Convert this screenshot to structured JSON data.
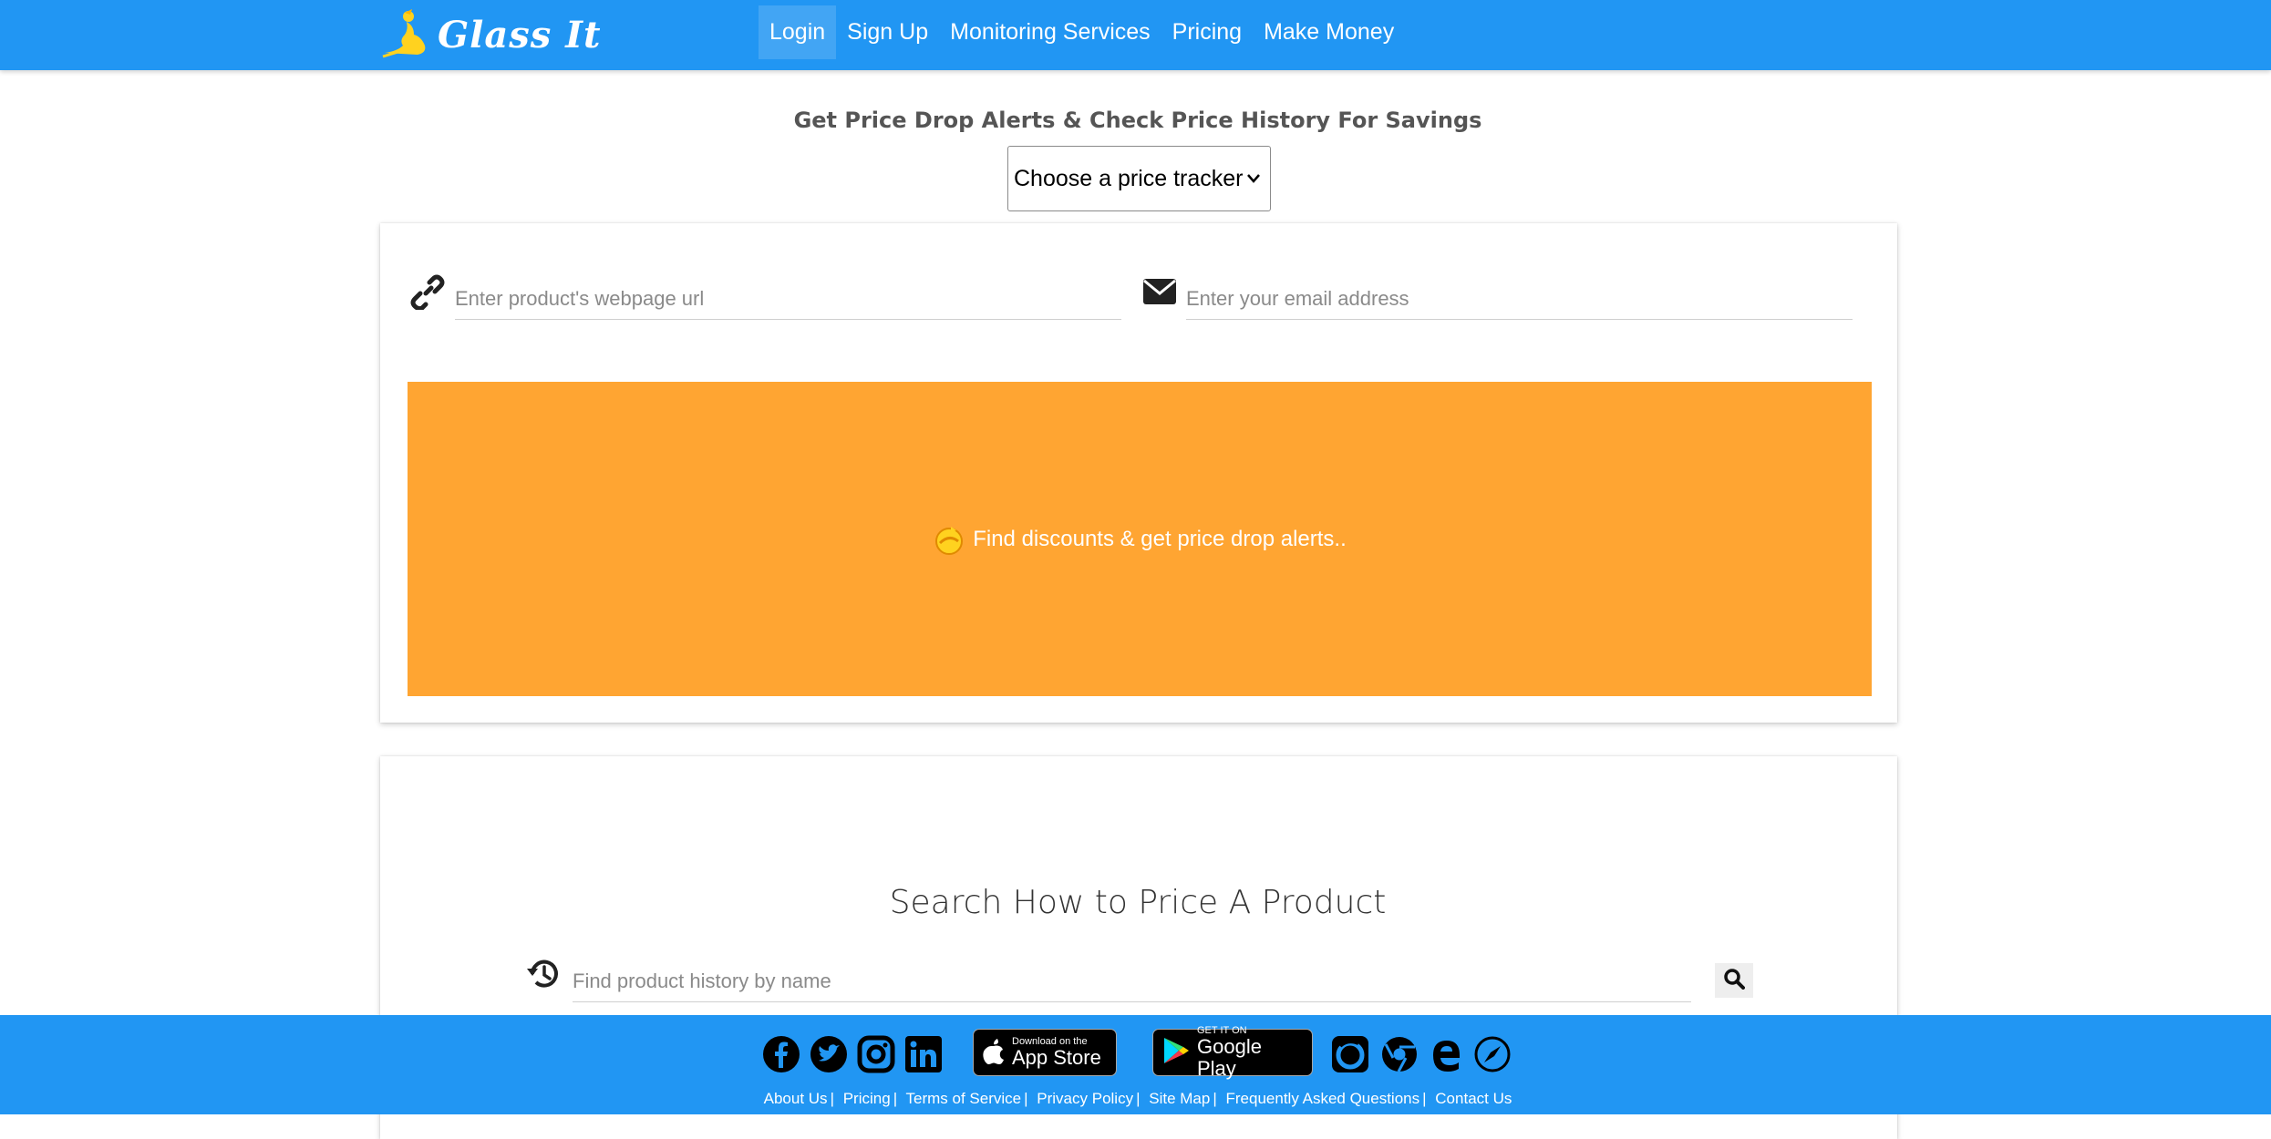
{
  "header": {
    "logo_text": "Glass It",
    "nav": [
      {
        "label": "Login"
      },
      {
        "label": "Sign Up"
      },
      {
        "label": "Monitoring Services"
      },
      {
        "label": "Pricing"
      },
      {
        "label": "Make Money"
      }
    ]
  },
  "hero": {
    "title": "Get Price Drop Alerts & Check Price History For Savings",
    "tracker_select": "Choose a price tracker"
  },
  "alert_form": {
    "url_placeholder": "Enter product's webpage url",
    "email_placeholder": "Enter your email address",
    "cta_label": "Find discounts & get price drop alerts.."
  },
  "history_search": {
    "title": "Search How to Price A Product",
    "placeholder": "Find product history by name"
  },
  "footer": {
    "app_store": {
      "small": "Download on the",
      "big": "App Store"
    },
    "google_play": {
      "small": "GET IT ON",
      "big": "Google Play"
    },
    "links": [
      "About Us",
      "Pricing",
      "Terms of Service",
      "Privacy Policy",
      "Site Map",
      "Frequently Asked Questions",
      "Contact Us"
    ],
    "separator": "|"
  },
  "colors": {
    "primary_blue": "#2196f3",
    "cta_orange": "#ffa532"
  }
}
